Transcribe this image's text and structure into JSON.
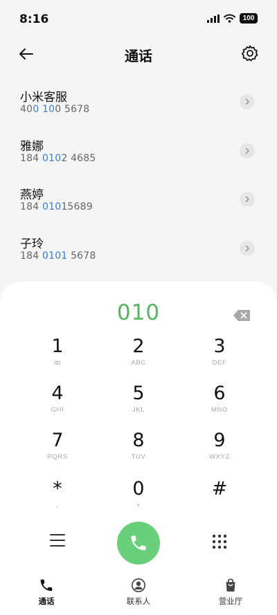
{
  "status_bar": {
    "time": "8:16",
    "battery": "100"
  },
  "header": {
    "title": "通话",
    "back_icon": "arrow-left-icon",
    "settings_icon": "gear-icon"
  },
  "contacts": [
    {
      "name": "小米客服",
      "number_parts": [
        "40",
        "0 10",
        "0 5678"
      ]
    },
    {
      "name": "雅娜",
      "number_parts": [
        "184 ",
        "010",
        "2 4685"
      ]
    },
    {
      "name": "燕婷",
      "number_parts": [
        "184 ",
        "010",
        "15689"
      ]
    },
    {
      "name": "子玲",
      "number_parts": [
        "184 ",
        "0101",
        " 5678"
      ]
    }
  ],
  "dialer": {
    "input": "010",
    "keys": [
      {
        "digit": "1",
        "letters": "ꝏ"
      },
      {
        "digit": "2",
        "letters": "ABC"
      },
      {
        "digit": "3",
        "letters": "DEF"
      },
      {
        "digit": "4",
        "letters": "GHI"
      },
      {
        "digit": "5",
        "letters": "JKL"
      },
      {
        "digit": "6",
        "letters": "MNO"
      },
      {
        "digit": "7",
        "letters": "PQRS"
      },
      {
        "digit": "8",
        "letters": "TUV"
      },
      {
        "digit": "9",
        "letters": "WXYZ"
      },
      {
        "digit": "*",
        "letters": ","
      },
      {
        "digit": "0",
        "letters": "+"
      },
      {
        "digit": "#",
        "letters": ""
      }
    ]
  },
  "tabs": [
    {
      "label": "通话",
      "icon": "phone-icon",
      "active": true
    },
    {
      "label": "联系人",
      "icon": "contact-icon",
      "active": false
    },
    {
      "label": "营业厅",
      "icon": "shopping-bag-icon",
      "active": false
    }
  ],
  "colors": {
    "accent_green": "#55b45f",
    "call_button": "#69cf7a",
    "highlight_blue": "#3a79d6"
  }
}
